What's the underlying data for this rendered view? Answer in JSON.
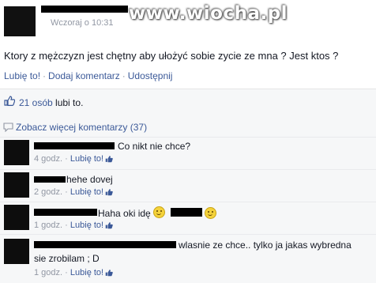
{
  "post": {
    "timestamp": "Wczoraj o 10:31",
    "watermark": "www.wiocha.pl",
    "text": "Ktory z mężczyzn jest chętny aby ułożyć sobie zycie ze mna ? Jest ktos ?",
    "actions": {
      "like": "Lubię to!",
      "comment": "Dodaj komentarz",
      "share": "Udostępnij",
      "separator": "·"
    }
  },
  "likes": {
    "count_text": "21 osób",
    "suffix": "lubi to."
  },
  "more_comments": "Zobacz więcej komentarzy (37)",
  "comments": [
    {
      "text": "Co nikt nie chce?",
      "age": "4 godz.",
      "like": "Lubię to!"
    },
    {
      "text": "hehe dovej",
      "age": "2 godz.",
      "like": "Lubię to!"
    },
    {
      "text": "Haha oki idę",
      "age": "1 godz.",
      "like": "Lubię to!"
    },
    {
      "text": "wlasnie ze chce.. tylko ja jakas wybredna",
      "text2": "sie zrobilam ; D",
      "age": "1 godz.",
      "like": "Lubię to!"
    }
  ],
  "colors": {
    "link": "#3b5998",
    "meta": "#9197a3",
    "panel": "#f6f7f8"
  }
}
